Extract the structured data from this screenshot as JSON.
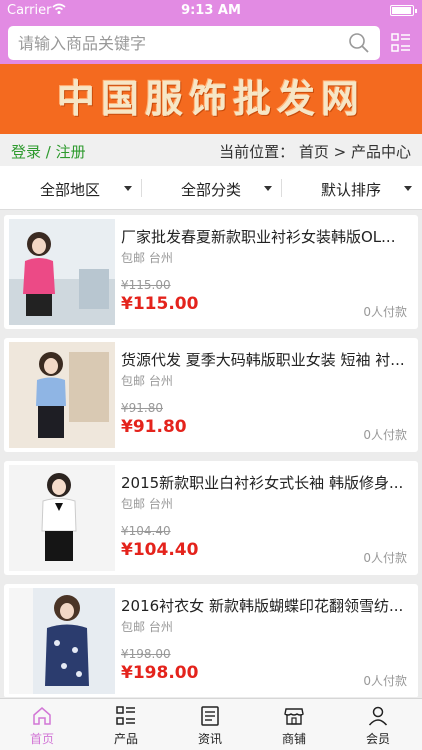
{
  "status_bar": {
    "carrier": "Carrier",
    "time": "9:13 AM"
  },
  "search": {
    "placeholder": "请输入商品关键字",
    "value": ""
  },
  "banner": {
    "text": "中国服饰批发网"
  },
  "breadcrumb": {
    "login": "登录",
    "separator": "/",
    "register": "注册",
    "location": "当前位置： 首页 > 产品中心"
  },
  "filters": [
    {
      "label": "全部地区"
    },
    {
      "label": "全部分类"
    },
    {
      "label": "默认排序"
    }
  ],
  "products": [
    {
      "title": "厂家批发春夏新款职业衬衫女装韩版OL...",
      "meta": "包邮 台州",
      "old_price": "¥115.00",
      "price": "¥115.00",
      "paid": "0人付款"
    },
    {
      "title": "货源代发 夏季大码韩版职业女装 短袖 衬...",
      "meta": "包邮 台州",
      "old_price": "¥91.80",
      "price": "¥91.80",
      "paid": "0人付款"
    },
    {
      "title": "2015新款职业白衬衫女式长袖 韩版修身...",
      "meta": "包邮 台州",
      "old_price": "¥104.40",
      "price": "¥104.40",
      "paid": "0人付款"
    },
    {
      "title": "2016衬衣女 新款韩版蝴蝶印花翻领雪纺...",
      "meta": "包邮 台州",
      "old_price": "¥198.00",
      "price": "¥198.00",
      "paid": "0人付款"
    }
  ],
  "tabs": [
    {
      "label": "首页",
      "icon": "home-icon"
    },
    {
      "label": "产品",
      "icon": "grid-list-icon"
    },
    {
      "label": "资讯",
      "icon": "news-icon"
    },
    {
      "label": "商铺",
      "icon": "store-icon"
    },
    {
      "label": "会员",
      "icon": "user-icon"
    }
  ],
  "colors": {
    "accent": "#e28be3",
    "banner": "#f46a1f",
    "price": "#e4231c",
    "link": "#2e9a2e"
  }
}
